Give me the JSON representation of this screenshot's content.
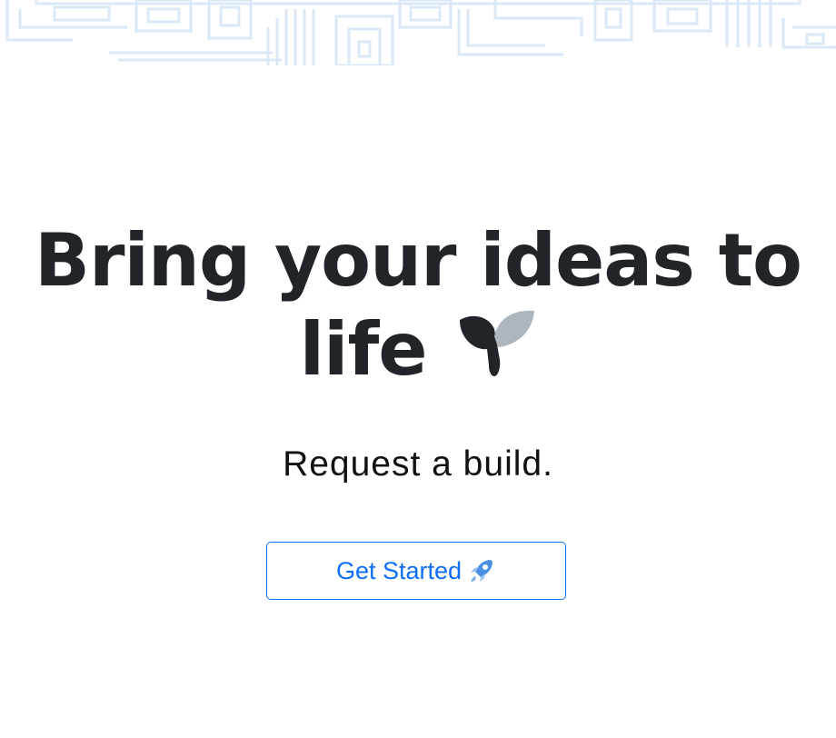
{
  "hero": {
    "headline": "Bring your ideas to life",
    "subheadline": "Request a build.",
    "icon": "sprout-icon"
  },
  "cta": {
    "label": "Get Started",
    "icon": "rocket-icon"
  },
  "colors": {
    "heading": "#212529",
    "accent": "#0d6efd",
    "pattern": "#dbe8f7",
    "sprout_dark": "#212529",
    "sprout_light": "#adb5bd"
  }
}
